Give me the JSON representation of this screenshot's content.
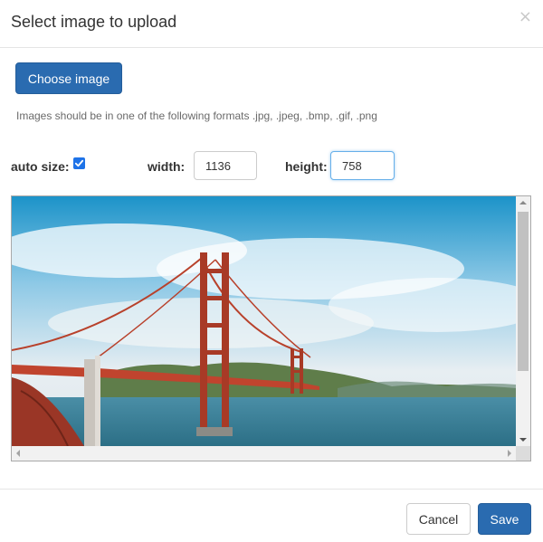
{
  "dialog": {
    "title": "Select image to upload",
    "close_glyph": "×"
  },
  "upload": {
    "choose_label": "Choose image",
    "help_text": "Images should be in one of the following formats .jpg, .jpeg, .bmp, .gif, .png"
  },
  "size": {
    "auto_size_label": "auto size:",
    "auto_size_checked": true,
    "width_label": "width:",
    "width_value": "1136",
    "height_label": "height:",
    "height_value": "758"
  },
  "preview": {
    "image_icon": "photo-of-bridge-icon"
  },
  "footer": {
    "cancel_label": "Cancel",
    "save_label": "Save"
  },
  "colors": {
    "primary": "#2a6bb0",
    "checkbox": "#1e73e8",
    "focus_border": "#66afe9"
  }
}
